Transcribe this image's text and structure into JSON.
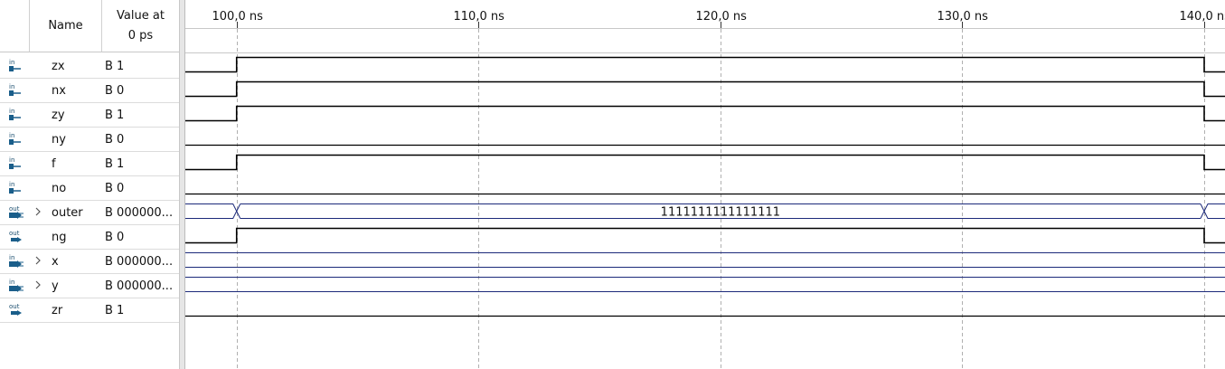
{
  "header": {
    "name_label": "Name",
    "value_label_line1": "Value at",
    "value_label_line2": "0 ps"
  },
  "timeline": {
    "start_ns": 97.88,
    "end_ns": 140.86,
    "ticks": [
      {
        "ns": 100,
        "label": "100,0 ns"
      },
      {
        "ns": 110,
        "label": "110,0 ns"
      },
      {
        "ns": 120,
        "label": "120,0 ns"
      },
      {
        "ns": 130,
        "label": "130,0 ns"
      },
      {
        "ns": 140,
        "label": "140,0 ns"
      }
    ]
  },
  "signals": [
    {
      "id": "zx",
      "name": "zx",
      "dir": "in",
      "icon": "input-pin-icon",
      "value": "B 1",
      "bus": false,
      "wave": "low-high-low",
      "transitions_ns": [
        100.0,
        140.0
      ]
    },
    {
      "id": "nx",
      "name": "nx",
      "dir": "in",
      "icon": "input-pin-icon",
      "value": "B 0",
      "bus": false,
      "wave": "low-high-low",
      "transitions_ns": [
        100.0,
        140.0
      ]
    },
    {
      "id": "zy",
      "name": "zy",
      "dir": "in",
      "icon": "input-pin-icon",
      "value": "B 1",
      "bus": false,
      "wave": "low-high-low",
      "transitions_ns": [
        100.0,
        140.0
      ]
    },
    {
      "id": "ny",
      "name": "ny",
      "dir": "in",
      "icon": "input-pin-icon",
      "value": "B 0",
      "bus": false,
      "wave": "low",
      "transitions_ns": []
    },
    {
      "id": "f",
      "name": "f",
      "dir": "in",
      "icon": "input-pin-icon",
      "value": "B 1",
      "bus": false,
      "wave": "low-high-low",
      "transitions_ns": [
        100.0,
        140.0
      ]
    },
    {
      "id": "no",
      "name": "no",
      "dir": "in",
      "icon": "input-pin-icon",
      "value": "B 0",
      "bus": false,
      "wave": "low",
      "transitions_ns": []
    },
    {
      "id": "outer",
      "name": "outer",
      "dir": "out",
      "icon": "output-bus-icon",
      "value": "B 000000...",
      "bus": true,
      "wave": "bus",
      "transitions_ns": [
        100.0,
        140.0
      ],
      "bus_value": "1111111111111111"
    },
    {
      "id": "ng",
      "name": "ng",
      "dir": "out",
      "icon": "output-pin-icon",
      "value": "B 0",
      "bus": false,
      "wave": "low-high-low",
      "transitions_ns": [
        100.0,
        140.0
      ]
    },
    {
      "id": "x",
      "name": "x",
      "dir": "in",
      "icon": "input-bus-icon",
      "value": "B 000000...",
      "bus": true,
      "wave": "bus-const",
      "transitions_ns": []
    },
    {
      "id": "y",
      "name": "y",
      "dir": "in",
      "icon": "input-bus-icon",
      "value": "B 000000...",
      "bus": true,
      "wave": "bus-const",
      "transitions_ns": []
    },
    {
      "id": "zr",
      "name": "zr",
      "dir": "out",
      "icon": "output-pin-icon",
      "value": "B 1",
      "bus": false,
      "wave": "low",
      "transitions_ns": []
    }
  ],
  "colors": {
    "wave_line": "#000000",
    "bus_line": "#1c2a7a",
    "grid_dash": "#b0b0b0"
  }
}
